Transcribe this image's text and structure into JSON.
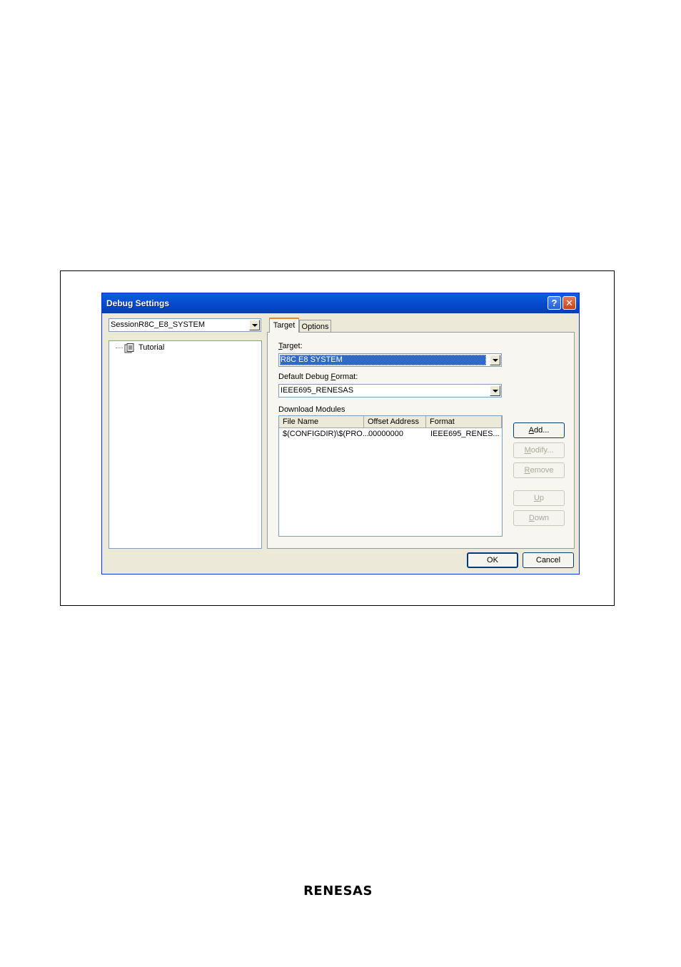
{
  "dialog": {
    "title": "Debug Settings",
    "help_button": "?",
    "close_button": "✕"
  },
  "session": {
    "selected": "SessionR8C_E8_SYSTEM",
    "tree": [
      {
        "label": "Tutorial"
      }
    ]
  },
  "tabs": [
    {
      "label": "Target",
      "active": true
    },
    {
      "label": "Options",
      "active": false
    }
  ],
  "target": {
    "label": "Target:",
    "value": "R8C E8 SYSTEM"
  },
  "debug_format": {
    "label": "Default Debug Format:",
    "value": "IEEE695_RENESAS"
  },
  "modules": {
    "label": "Download Modules",
    "columns": [
      "File Name",
      "Offset Address",
      "Format"
    ],
    "rows": [
      [
        "$(CONFIGDIR)\\$(PRO...",
        "00000000",
        "IEEE695_RENES..."
      ]
    ]
  },
  "side_buttons": {
    "add": "Add...",
    "modify": "Modify...",
    "remove": "Remove",
    "up": "Up",
    "down": "Down"
  },
  "footer_buttons": {
    "ok": "OK",
    "cancel": "Cancel"
  },
  "logo_text": "RENESAS",
  "colors": {
    "titlebar": "#0a4fd1",
    "selection": "#316ac5",
    "dialog_bg": "#ece9d8"
  }
}
